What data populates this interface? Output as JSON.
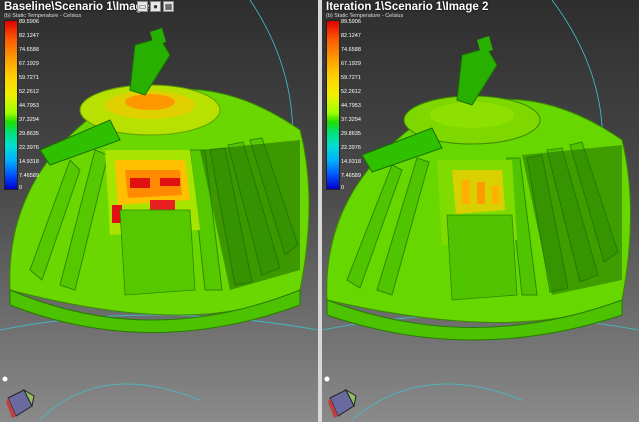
{
  "left_view": {
    "title": "Baseline\\Scenario 1\\Image 2",
    "legend_caption": "(b) Static Temperature - Celsius",
    "toolbar": [
      {
        "icon": "page-icon",
        "glyph": "▭"
      },
      {
        "icon": "palette-icon",
        "glyph": "●"
      },
      {
        "icon": "grid-icon",
        "glyph": "▦"
      }
    ]
  },
  "right_view": {
    "title": "Iteration 1\\Scenario 1\\Image 2",
    "legend_caption": "(b) Static Temperature - Celsius"
  },
  "legend_values": [
    "89.5906",
    "82.1247",
    "74.6588",
    "67.1929",
    "59.7271",
    "52.2612",
    "44.7953",
    "37.3294",
    "29.8635",
    "22.3976",
    "14.9318",
    "7.46589",
    "0"
  ],
  "colors": {
    "hot": "#e01010",
    "warm": "#ffb000",
    "mid": "#7ee000",
    "cool": "#33dd00",
    "dark_green": "#1f7d00"
  }
}
